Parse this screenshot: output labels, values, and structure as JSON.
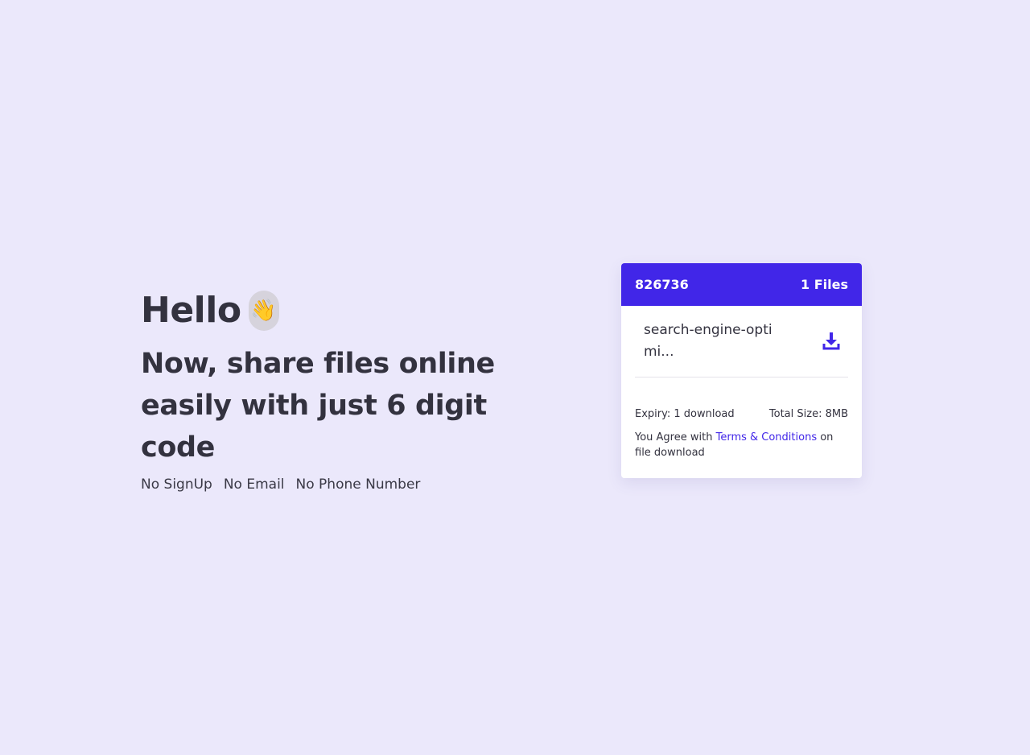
{
  "hero": {
    "greeting": "Hello",
    "wave_emoji": "👋",
    "headline": "Now, share files online easily with just 6 digit code",
    "features": [
      "No SignUp",
      "No Email",
      "No Phone Number"
    ]
  },
  "card": {
    "code": "826736",
    "file_count": "1 Files",
    "file_name": "search-engine-optimi...",
    "download_icon": "download-icon",
    "expiry": "Expiry: 1 download",
    "total_size": "Total Size: 8MB",
    "terms_prefix": "You Agree with ",
    "terms_link": "Terms & Conditions",
    "terms_suffix": " on file download"
  },
  "colors": {
    "background": "#ebe8fb",
    "accent": "#4126e8",
    "text": "#33323f"
  }
}
